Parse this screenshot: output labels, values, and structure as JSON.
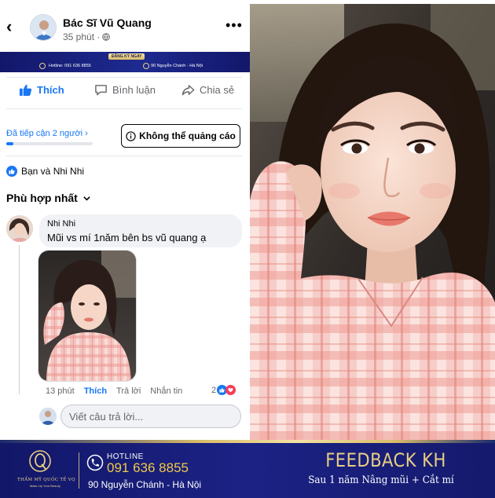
{
  "header": {
    "page_name": "Bác Sĩ Vũ Quang",
    "time": "35 phút ·",
    "back_icon": "chevron-left-icon",
    "more_icon": "more-horizontal-icon"
  },
  "banner_strip": {
    "button": "ĐĂNG KÝ NGAY",
    "hotline": "Hotline: 091 636 8855",
    "address": "90 Nguyễn Chánh - Hà Nội"
  },
  "actions": {
    "like": "Thích",
    "comment": "Bình luận",
    "share": "Chia sẻ"
  },
  "reach": {
    "text": "Đã tiếp cận 2 người ›",
    "progress_percent": 8,
    "cant_advertise": "Không thể quảng cáo"
  },
  "reactions": {
    "text": "Bạn và Nhi Nhi"
  },
  "sort": {
    "label": "Phù hợp nhất"
  },
  "comment": {
    "author": "Nhi Nhi",
    "text": "Mũi vs mí 1năm bên bs vũ quang ạ",
    "time": "13 phút",
    "like": "Thích",
    "reply": "Trả lời",
    "message": "Nhắn tin",
    "reaction_count": "2"
  },
  "reply_box": {
    "placeholder": "Viết câu trả lời..."
  },
  "bottom_banner": {
    "logo_text": "THẨM MỸ QUỐC TẾ VQ",
    "logo_sub": "Make Up Your Beauty",
    "hotline_label": "HOTLINE",
    "hotline_number": "091 636 8855",
    "address": "90 Nguyễn Chánh - Hà Nội",
    "feedback_title": "FEEDBACK KH",
    "feedback_sub": "Sau 1 năm Nâng mũi + Cắt mí"
  },
  "colors": {
    "facebook_blue": "#1877f2",
    "banner_navy": "#151a6d",
    "gold": "#e8cd83"
  }
}
